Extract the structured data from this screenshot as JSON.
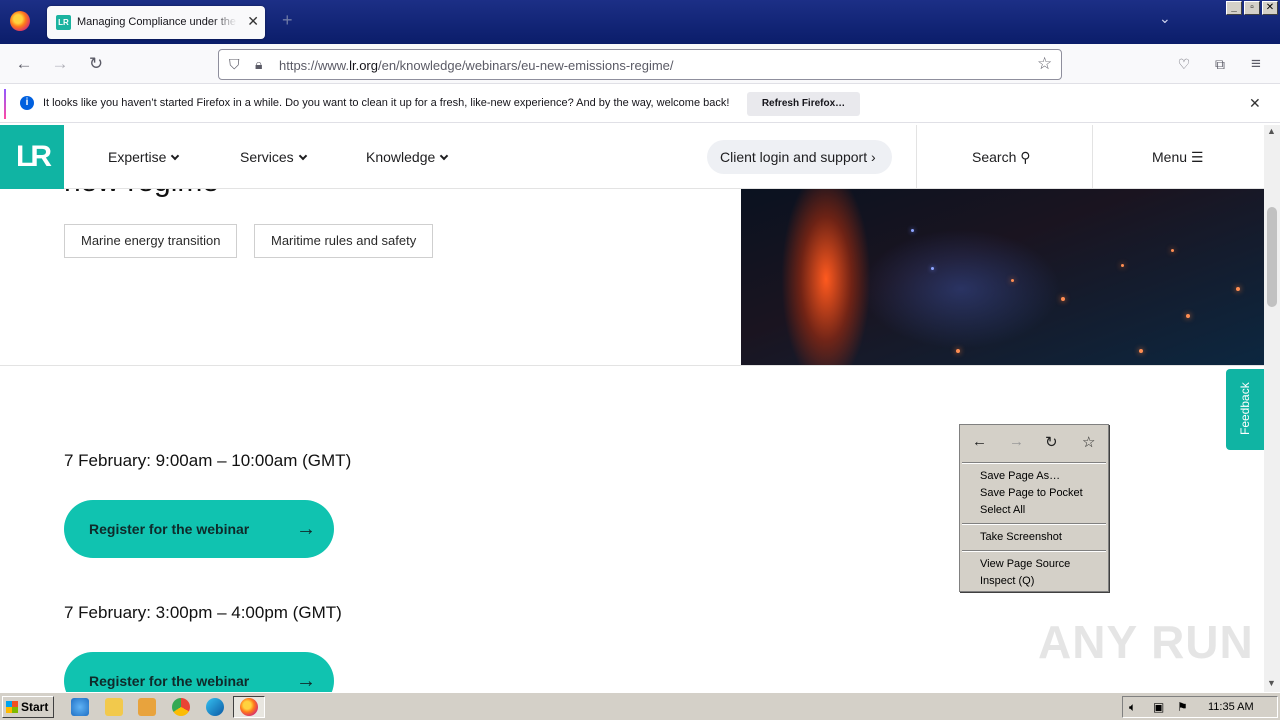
{
  "browser": {
    "tab_title": "Managing Compliance under the EU",
    "tab_favicon": "LR",
    "url_prefix": "https://www.",
    "url_host": "lr.org",
    "url_path": "/en/knowledge/webinars/eu-new-emissions-regime/",
    "notification_text": "It looks like you haven’t started Firefox in a while. Do you want to clean it up for a fresh, like-new experience? And by the way, welcome back!",
    "notification_button": "Refresh Firefox…"
  },
  "site": {
    "logo": "LR",
    "nav": [
      "Expertise",
      "Services",
      "Knowledge"
    ],
    "client_login": "Client login and support",
    "search": "Search",
    "menu": "Menu",
    "hero_title_partial": "new regime",
    "tags": [
      "Marine energy transition",
      "Maritime rules and safety"
    ],
    "sessions": [
      {
        "time": "7 February: 9:00am – 10:00am (GMT)",
        "button": "Register for the webinar"
      },
      {
        "time": "7 February: 3:00pm – 4:00pm (GMT)",
        "button": "Register for the webinar"
      }
    ],
    "feedback": "Feedback",
    "accent_color": "#10b4a3"
  },
  "context_menu": {
    "items": [
      "Save Page As…",
      "Save Page to Pocket",
      "Select All",
      "Take Screenshot",
      "View Page Source",
      "Inspect (Q)"
    ]
  },
  "watermark": "ANY RUN",
  "taskbar": {
    "start": "Start",
    "clock": "11:35 AM"
  }
}
